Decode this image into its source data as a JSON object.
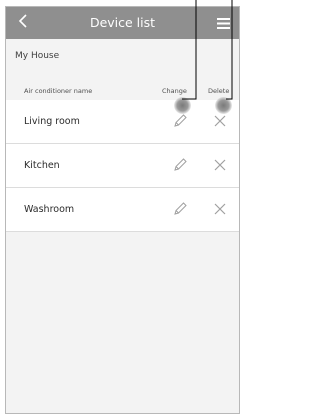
{
  "header": {
    "back_icon": "chevron-left-icon",
    "title": "Device list",
    "menu_icon": "hamburger-menu-icon"
  },
  "section": {
    "title": "My House"
  },
  "columns": {
    "name": "Air conditioner name",
    "change": "Change",
    "delete": "Delete"
  },
  "devices": [
    {
      "name": "Living room"
    },
    {
      "name": "Kitchen"
    },
    {
      "name": "Washroom"
    }
  ],
  "icons": {
    "edit": "pencil-icon",
    "delete": "close-icon"
  },
  "colors": {
    "topbar": "#8f8f8f",
    "background": "#f3f3f3",
    "row_bg": "#ffffff",
    "divider": "#dcdcdc"
  }
}
